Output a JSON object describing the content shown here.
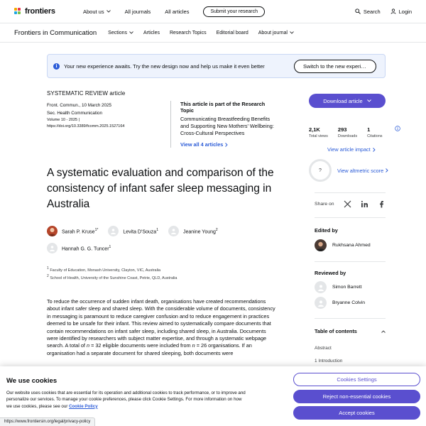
{
  "topnav": {
    "logo_text": "frontiers",
    "links": [
      "About us",
      "All journals",
      "All articles"
    ],
    "submit_label": "Submit your research",
    "search_label": "Search",
    "login_label": "Login"
  },
  "journal_nav": {
    "journal_name": "Frontiers in Communication",
    "links": [
      "Sections",
      "Articles",
      "Research Topics",
      "Editorial board",
      "About journal"
    ]
  },
  "banner": {
    "text": "Your new experience awaits. Try the new design now and help us make it even better",
    "button_label": "Switch to the new experience"
  },
  "article": {
    "type": "SYSTEMATIC REVIEW article",
    "citation_line1": "Front. Commun., 10 March 2025",
    "citation_line2": "Sec. Health Communication",
    "volume": "Volume 10 - 2025 |",
    "doi": "https://doi.org/10.3389/fcomm.2025.1527164",
    "topic_label": "This article is part of the Research Topic",
    "topic_title": "Communicating Breastfeeding Benefits and Supporting New Mothers' Wellbeing: Cross-Cultural Perspectives",
    "topic_link": "View all 4 articles",
    "title": "A systematic evaluation and comparison of the consistency of infant safer sleep messaging in Australia",
    "authors": [
      {
        "name": "Sarah P. Kruse",
        "sup": "1*"
      },
      {
        "name": "Levita D'Souza",
        "sup": "1"
      },
      {
        "name": "Jeanine Young",
        "sup": "2"
      },
      {
        "name": "Hannah G. G. Tuncer",
        "sup": "1"
      }
    ],
    "affil1_num": "1",
    "affil1": "Faculty of Education, Monash University, Clayton, VIC, Australia",
    "affil2_num": "2",
    "affil2": "School of Health, University of the Sunshine Coast, Petrie, QLD, Australia",
    "abstract_part1": "To reduce the occurrence of sudden infant death, organisations have created recommendations about infant safer sleep and shared sleep. With the considerable volume of documents, consistency in messaging is paramount to reduce caregiver confusion and to reduce engagement in practices deemed to be unsafe for their infant. This review aimed to systematically compare documents that contain recommendations on infant safer sleep, including shared sleep, in Australia. Documents were identified by researchers with subject matter expertise, and through a systematic webpage search. A total of ",
    "abstract_n1": "n",
    "abstract_part2": " = 32 eligible documents were included from ",
    "abstract_n2": "n",
    "abstract_part3": " = 26 organisations. If an organisation had a separate document for shared sleeping, both documents were"
  },
  "sidebar": {
    "download_label": "Download article",
    "stats": [
      {
        "num": "2,1K",
        "label": "Total views"
      },
      {
        "num": "293",
        "label": "Downloads"
      },
      {
        "num": "1",
        "label": "Citations"
      }
    ],
    "impact_link": "View article impact",
    "altmetric_value": "?",
    "altmetric_link": "View altmetric score",
    "share_label": "Share on",
    "edited_by_label": "Edited by",
    "editor": "Rukhsana Ahmed",
    "reviewed_by_label": "Reviewed by",
    "reviewers": [
      "Simon Barrett",
      "Bryanne Colvin"
    ],
    "toc_label": "Table of contents",
    "toc_items": [
      "Abstract",
      "1 Introduction"
    ]
  },
  "cookie": {
    "title": "We use cookies",
    "text": "Our website uses cookies that are essential for its operation and additional cookies to track performance, or to improve and personalize our services. To manage your cookie preferences, please click Cookie Settings. For more information on how we use cookies, please see our ",
    "policy_link": "Cookie Policy",
    "settings_label": "Cookies Settings",
    "reject_label": "Reject non-essential cookies",
    "accept_label": "Accept cookies"
  },
  "status_url": "https://www.frontiersin.org/legal/privacy-policy",
  "colors": {
    "accent": "#5a4fcf",
    "link": "#2a5bd7",
    "text": "#0c0e10",
    "banner_bg": "#eef3fd"
  }
}
